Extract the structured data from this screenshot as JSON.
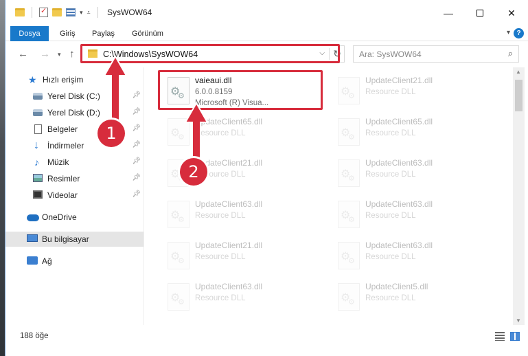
{
  "window": {
    "title": "SysWOW64",
    "minimize": "—",
    "close": "✕"
  },
  "ribbon": {
    "tabs": [
      "Dosya",
      "Giriş",
      "Paylaş",
      "Görünüm"
    ],
    "help": "?"
  },
  "nav": {
    "address": "C:\\Windows\\SysWOW64",
    "search_placeholder": "Ara: SysWOW64"
  },
  "sidebar": {
    "items": [
      {
        "label": "Hızlı erişim",
        "icon": "star-icon",
        "pinned": false
      },
      {
        "label": "Yerel Disk (C:)",
        "icon": "drive-icon",
        "pinned": true
      },
      {
        "label": "Yerel Disk (D:)",
        "icon": "drive-icon",
        "pinned": true
      },
      {
        "label": "Belgeler",
        "icon": "document-icon",
        "pinned": true
      },
      {
        "label": "İndirmeler",
        "icon": "download-icon",
        "pinned": true
      },
      {
        "label": "Müzik",
        "icon": "music-icon",
        "pinned": true
      },
      {
        "label": "Resimler",
        "icon": "pictures-icon",
        "pinned": true
      },
      {
        "label": "Videolar",
        "icon": "video-icon",
        "pinned": true
      },
      {
        "label": "OneDrive",
        "icon": "cloud-icon",
        "pinned": false
      },
      {
        "label": "Bu bilgisayar",
        "icon": "computer-icon",
        "pinned": false,
        "selected": true
      },
      {
        "label": "Ağ",
        "icon": "network-icon",
        "pinned": false
      }
    ]
  },
  "files": {
    "highlighted": {
      "name": "vaieaui.dll",
      "version": "6.0.0.8159",
      "description": "Microsoft (R) Visua..."
    },
    "background": [
      {
        "name": "UpdateClient21.dll",
        "description": "Resource DLL"
      },
      {
        "name": "UpdateClient65.dll",
        "description": "Resource DLL"
      },
      {
        "name": "UpdateClient65.dll",
        "description": "Resource DLL"
      },
      {
        "name": "UpdateClient21.dll",
        "description": "Resource DLL"
      },
      {
        "name": "UpdateClient63.dll",
        "description": "Resource DLL"
      },
      {
        "name": "UpdateClient63.dll",
        "description": "Resource DLL"
      },
      {
        "name": "UpdateClient63.dll",
        "description": "Resource DLL"
      },
      {
        "name": "UpdateClient21.dll",
        "description": "Resource DLL"
      },
      {
        "name": "UpdateClient63.dll",
        "description": "Resource DLL"
      },
      {
        "name": "UpdateClient63.dll",
        "description": "Resource DLL"
      },
      {
        "name": "UpdateClient5.dll",
        "description": "Resource DLL"
      }
    ]
  },
  "status": {
    "item_count": "188 öğe"
  },
  "annotations": {
    "step1": "1",
    "step2": "2",
    "color": "#d72c3c"
  }
}
